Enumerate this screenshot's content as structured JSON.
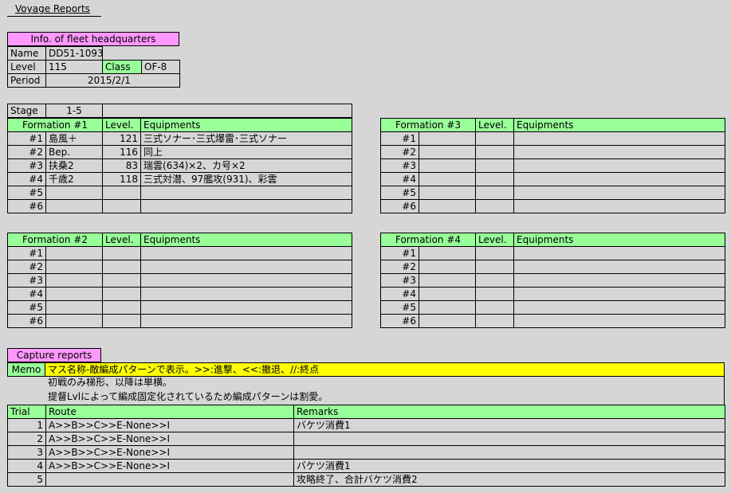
{
  "title": "Voyage Reports",
  "hq": {
    "header": "Info. of fleet headquarters",
    "name_label": "Name",
    "name_value": "DD51-1093",
    "level_label": "Level",
    "level_value": "115",
    "class_label": "Class",
    "class_value": "OF-8",
    "period_label": "Period",
    "period_value": "2015/2/1"
  },
  "stage": {
    "label": "Stage",
    "value": "1-5"
  },
  "headers": {
    "level": "Level.",
    "equipments": "Equipments"
  },
  "formations": [
    {
      "title": "Formation #1",
      "rows": [
        {
          "no": "#1",
          "ship": "島風＋",
          "level": "121",
          "equip": "三式ソナー･三式爆雷･三式ソナー"
        },
        {
          "no": "#2",
          "ship": "Bep.",
          "level": "116",
          "equip": "同上"
        },
        {
          "no": "#3",
          "ship": "扶桑2",
          "level": "83",
          "equip": "瑞雲(634)×2、カ号×2"
        },
        {
          "no": "#4",
          "ship": "千歳2",
          "level": "118",
          "equip": "三式対潜、97艦攻(931)、彩雲"
        },
        {
          "no": "#5",
          "ship": "",
          "level": "",
          "equip": ""
        },
        {
          "no": "#6",
          "ship": "",
          "level": "",
          "equip": ""
        }
      ]
    },
    {
      "title": "Formation #2",
      "rows": [
        {
          "no": "#1",
          "ship": "",
          "level": "",
          "equip": ""
        },
        {
          "no": "#2",
          "ship": "",
          "level": "",
          "equip": ""
        },
        {
          "no": "#3",
          "ship": "",
          "level": "",
          "equip": ""
        },
        {
          "no": "#4",
          "ship": "",
          "level": "",
          "equip": ""
        },
        {
          "no": "#5",
          "ship": "",
          "level": "",
          "equip": ""
        },
        {
          "no": "#6",
          "ship": "",
          "level": "",
          "equip": ""
        }
      ]
    },
    {
      "title": "Formation #3",
      "rows": [
        {
          "no": "#1",
          "ship": "",
          "level": "",
          "equip": ""
        },
        {
          "no": "#2",
          "ship": "",
          "level": "",
          "equip": ""
        },
        {
          "no": "#3",
          "ship": "",
          "level": "",
          "equip": ""
        },
        {
          "no": "#4",
          "ship": "",
          "level": "",
          "equip": ""
        },
        {
          "no": "#5",
          "ship": "",
          "level": "",
          "equip": ""
        },
        {
          "no": "#6",
          "ship": "",
          "level": "",
          "equip": ""
        }
      ]
    },
    {
      "title": "Formation #4",
      "rows": [
        {
          "no": "#1",
          "ship": "",
          "level": "",
          "equip": ""
        },
        {
          "no": "#2",
          "ship": "",
          "level": "",
          "equip": ""
        },
        {
          "no": "#3",
          "ship": "",
          "level": "",
          "equip": ""
        },
        {
          "no": "#4",
          "ship": "",
          "level": "",
          "equip": ""
        },
        {
          "no": "#5",
          "ship": "",
          "level": "",
          "equip": ""
        },
        {
          "no": "#6",
          "ship": "",
          "level": "",
          "equip": ""
        }
      ]
    }
  ],
  "capture": {
    "header": "Capture reports",
    "memo_label": "Memo",
    "memo_lines": [
      "マス名称-敵編成パターンで表示。>>:進撃、<<:撤退、//:終点",
      "初戦のみ梯形、以降は単横。",
      "提督Lvlによって編成固定化されているため編成パターンは割愛。"
    ],
    "columns": {
      "trial": "Trial",
      "route": "Route",
      "remarks": "Remarks"
    },
    "rows": [
      {
        "trial": "1",
        "route": "A>>B>>C>>E-None>>I",
        "remarks": "バケツ消費1"
      },
      {
        "trial": "2",
        "route": "A>>B>>C>>E-None>>I",
        "remarks": ""
      },
      {
        "trial": "3",
        "route": "A>>B>>C>>E-None>>I",
        "remarks": ""
      },
      {
        "trial": "4",
        "route": "A>>B>>C>>E-None>>I",
        "remarks": "バケツ消費1"
      },
      {
        "trial": "5",
        "route": "",
        "remarks": "攻略終了、合計バケツ消費2"
      }
    ]
  }
}
